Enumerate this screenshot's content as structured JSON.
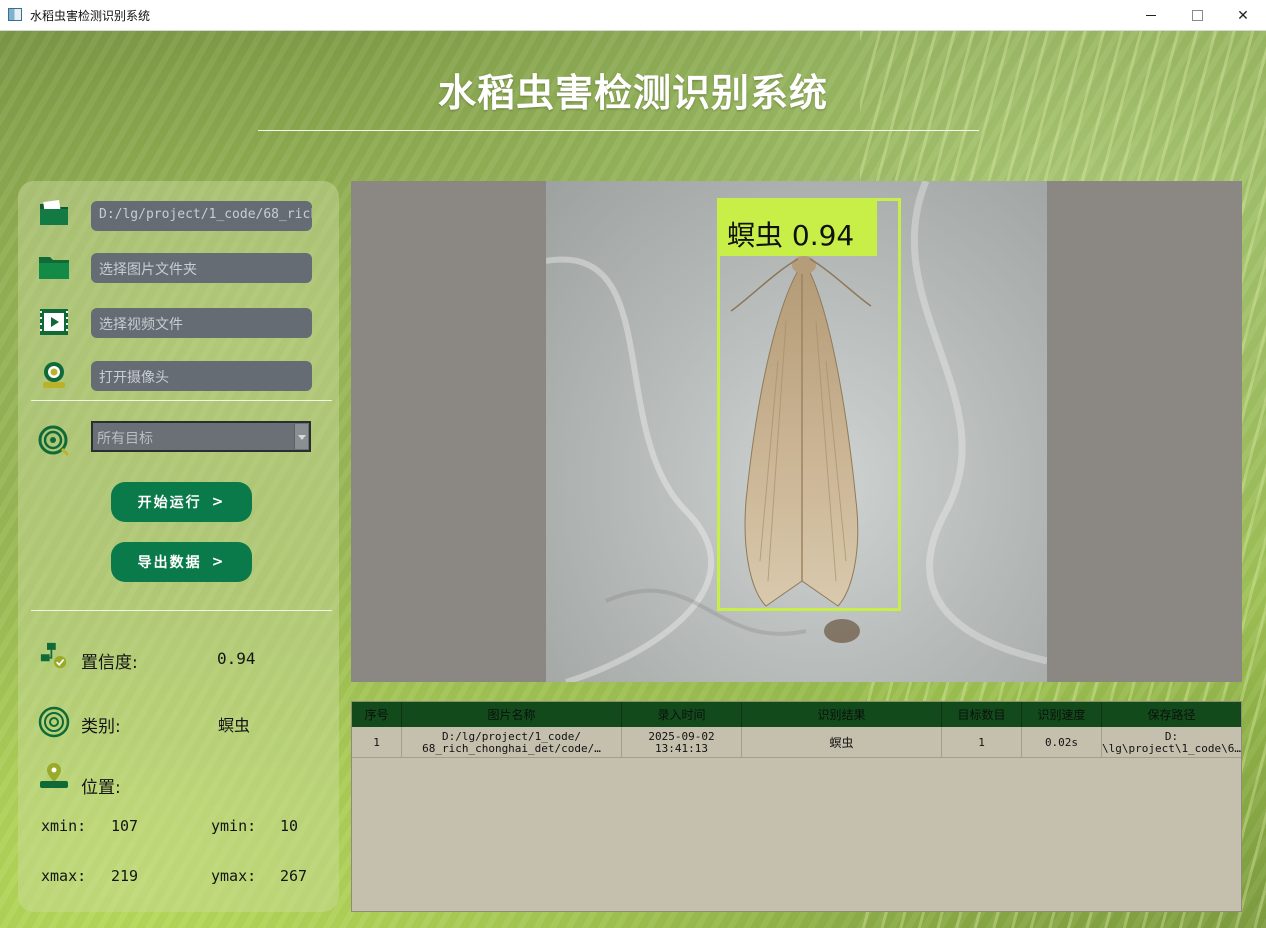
{
  "window": {
    "title": "水稻虫害检测识别系统",
    "minimize_icon": "minimize-icon",
    "maximize_icon": "maximize-icon",
    "close_icon": "close-icon",
    "close_glyph": "✕"
  },
  "header": {
    "title": "水稻虫害检测识别系统"
  },
  "inputs": {
    "image_file": {
      "value": "D:/lg/project/1_code/68_rich_chonghai_det",
      "icon": "image-file-folder-icon"
    },
    "image_folder": {
      "placeholder": "选择图片文件夹",
      "icon": "folder-icon"
    },
    "video_file": {
      "placeholder": "选择视频文件",
      "icon": "video-file-icon"
    },
    "camera": {
      "placeholder": "打开摄像头",
      "icon": "camera-icon"
    },
    "target_select": {
      "value": "所有目标",
      "icon": "target-icon"
    }
  },
  "buttons": {
    "start": {
      "label": "开始运行",
      "chevron": ">"
    },
    "export": {
      "label": "导出数据",
      "chevron": ">"
    }
  },
  "results": {
    "confidence_label": "置信度:",
    "confidence_value": "0.94",
    "class_label": "类别:",
    "class_value": "螟虫",
    "position_label": "位置:",
    "xmin_label": "xmin:",
    "xmin_value": "107",
    "ymin_label": "ymin:",
    "ymin_value": "10",
    "xmax_label": "xmax:",
    "xmax_value": "219",
    "ymax_label": "ymax:",
    "ymax_value": "267"
  },
  "detection": {
    "label": "螟虫 0.94",
    "box_color": "#c8ef48"
  },
  "table": {
    "headers": [
      "序号",
      "图片名称",
      "录入时间",
      "识别结果",
      "目标数目",
      "识别速度",
      "保存路径"
    ],
    "rows": [
      [
        "1",
        "D:/lg/project/1_code/\n68_rich_chonghai_det/code/…",
        "2025-09-02\n13:41:13",
        "螟虫",
        "1",
        "0.02s",
        "D:\n\\lg\\project\\1_code\\6…"
      ]
    ]
  },
  "colors": {
    "accent_button": "#0a7a4a",
    "table_header": "#124a1c",
    "table_body": "#c5bfad"
  }
}
